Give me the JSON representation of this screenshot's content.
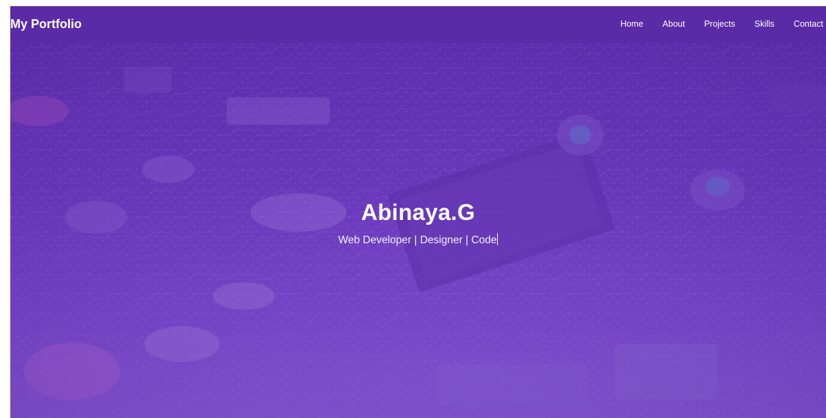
{
  "navbar": {
    "brand": "My Portfolio",
    "links": [
      "Home",
      "About",
      "Projects",
      "Skills",
      "Contact"
    ],
    "background": "#5a2aa7"
  },
  "hero": {
    "title": "Abinaya.G",
    "subtitle": "Web Developer | Designer | Code",
    "overlay_color": "#6a38bb",
    "background_image": "circuit-board-image"
  }
}
